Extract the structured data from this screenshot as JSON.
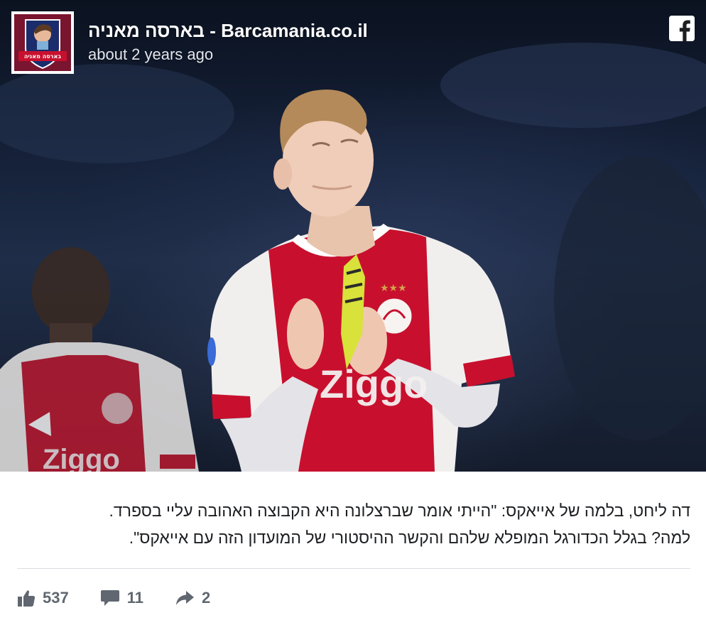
{
  "header": {
    "page_name": "בארסה מאניה - Barcamania.co.il",
    "timestamp": "about 2 years ago",
    "avatar_label": "בארסה מאניה",
    "avatar_bg": "#7a1530"
  },
  "post": {
    "lines": [
      "דה ליחט, בלמה של אייאקס: \"הייתי אומר שברצלונה היא הקבוצה האהובה עליי בספרד.",
      "למה? בגלל הכדורגל המופלא שלהם והקשר ההיסטורי של המועדון הזה עם אייאקס\"."
    ],
    "jersey_sponsor": "Ziggo"
  },
  "stats": {
    "likes": "537",
    "comments": "11",
    "shares": "2"
  },
  "icons": {
    "brand": "facebook-icon",
    "like": "thumbs-up-icon",
    "comment": "comment-icon",
    "share": "share-arrow-icon"
  },
  "colors": {
    "text": "#1c1e21",
    "muted": "#606770",
    "divider": "#dadde1",
    "jersey_red": "#c8102e"
  }
}
